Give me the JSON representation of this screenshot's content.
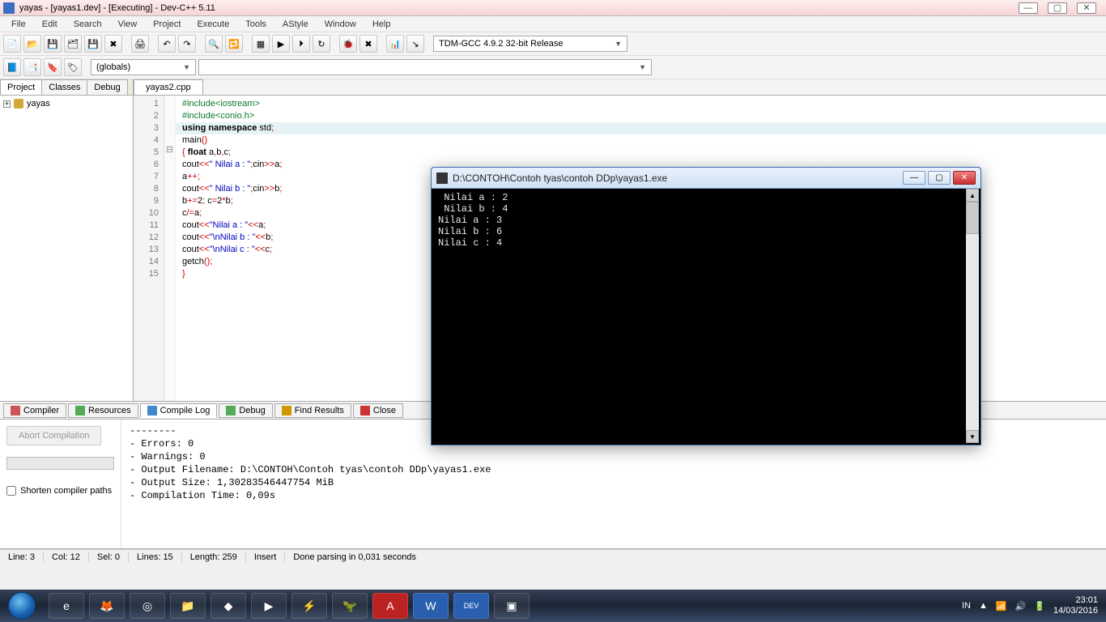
{
  "titlebar": {
    "title": "yayas - [yayas1.dev] - [Executing] - Dev-C++ 5.11",
    "min": "—",
    "max": "▢",
    "close": "✕"
  },
  "menu": [
    "File",
    "Edit",
    "Search",
    "View",
    "Project",
    "Execute",
    "Tools",
    "AStyle",
    "Window",
    "Help"
  ],
  "toolbar2": {
    "globals": "(globals)"
  },
  "compiler_combo": "TDM-GCC 4.9.2 32-bit Release",
  "side": {
    "tabs": [
      "Project",
      "Classes",
      "Debug"
    ],
    "root": "yayas"
  },
  "filetab": "yayas2.cpp",
  "code": {
    "lines": [
      {
        "n": "1",
        "fold": "",
        "html": "<span class='pp'>#include&lt;iostream&gt;</span>"
      },
      {
        "n": "2",
        "fold": "",
        "html": "<span class='pp'>#include&lt;conio.h&gt;</span>"
      },
      {
        "n": "3",
        "fold": "",
        "html": "<span class='kw'>using</span> <span class='kw'>namespace</span> std<span class='sym'>;</span>"
      },
      {
        "n": "4",
        "fold": "",
        "html": "main<span class='sym'>()</span>"
      },
      {
        "n": "5",
        "fold": "⊟",
        "html": "<span class='sym'>{</span> <span class='kw'>float</span> a<span class='sym'>,</span>b<span class='sym'>,</span>c<span class='sym'>;</span>"
      },
      {
        "n": "6",
        "fold": "",
        "html": "cout<span class='sym'>&lt;&lt;</span><span class='str'>\" Nilai a : \"</span><span class='sym'>;</span>cin<span class='sym'>&gt;&gt;</span>a<span class='sym'>;</span>"
      },
      {
        "n": "7",
        "fold": "",
        "html": "a<span class='sym'>++;</span>"
      },
      {
        "n": "8",
        "fold": "",
        "html": "cout<span class='sym'>&lt;&lt;</span><span class='str'>\" Nilai b : \"</span><span class='sym'>;</span>cin<span class='sym'>&gt;&gt;</span>b<span class='sym'>;</span>"
      },
      {
        "n": "9",
        "fold": "",
        "html": "b<span class='sym'>+=</span>2<span class='sym'>;</span> c<span class='sym'>=</span>2<span class='sym'>*</span>b<span class='sym'>;</span>"
      },
      {
        "n": "10",
        "fold": "",
        "html": "c<span class='sym'>/=</span>a<span class='sym'>;</span>"
      },
      {
        "n": "11",
        "fold": "",
        "html": "cout<span class='sym'>&lt;&lt;</span><span class='str'>\"Nilai a : \"</span><span class='sym'>&lt;&lt;</span>a<span class='sym'>;</span>"
      },
      {
        "n": "12",
        "fold": "",
        "html": "cout<span class='sym'>&lt;&lt;</span><span class='str'>\"\\nNilai b : \"</span><span class='sym'>&lt;&lt;</span>b<span class='sym'>;</span>"
      },
      {
        "n": "13",
        "fold": "",
        "html": "cout<span class='sym'>&lt;&lt;</span><span class='str'>\"\\nNilai c : \"</span><span class='sym'>&lt;&lt;</span>c<span class='sym'>;</span>"
      },
      {
        "n": "14",
        "fold": "",
        "html": "getch<span class='sym'>();</span>"
      },
      {
        "n": "15",
        "fold": "",
        "html": "<span class='sym'>}</span>"
      }
    ],
    "highlight_row": 3
  },
  "bottom_tabs": [
    {
      "label": "Compiler",
      "ic": "#c55"
    },
    {
      "label": "Resources",
      "ic": "#5a5"
    },
    {
      "label": "Compile Log",
      "ic": "#48c",
      "active": true
    },
    {
      "label": "Debug",
      "ic": "#5a5"
    },
    {
      "label": "Find Results",
      "ic": "#c90"
    },
    {
      "label": "Close",
      "ic": "#c33"
    }
  ],
  "btm_left": {
    "abort": "Abort Compilation",
    "shorten": "Shorten compiler paths"
  },
  "log": "--------\n- Errors: 0\n- Warnings: 0\n- Output Filename: D:\\CONTOH\\Contoh tyas\\contoh DDp\\yayas1.exe\n- Output Size: 1,30283546447754 MiB\n- Compilation Time: 0,09s",
  "status": {
    "line": "Line:   3",
    "col": "Col:   12",
    "sel": "Sel:   0",
    "lines": "Lines:   15",
    "length": "Length:  259",
    "mode": "Insert",
    "msg": "Done parsing in 0,031 seconds"
  },
  "console": {
    "title": "D:\\CONTOH\\Contoh tyas\\contoh DDp\\yayas1.exe",
    "out": " Nilai a : 2\n Nilai b : 4\nNilai a : 3\nNilai b : 6\nNilai c : 4"
  },
  "tray": {
    "lang": "IN",
    "time": "23:01",
    "date": "14/03/2016"
  }
}
